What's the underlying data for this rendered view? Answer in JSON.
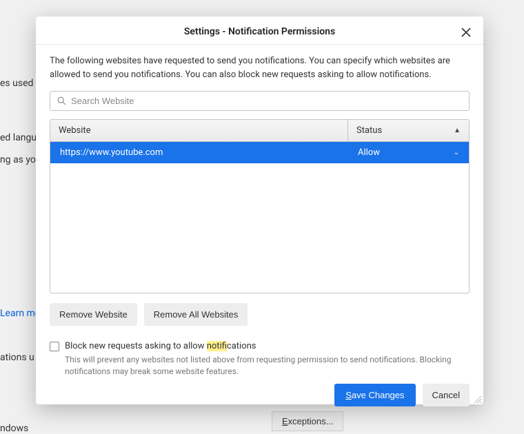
{
  "background": {
    "frag1": "es used",
    "frag2": "ed langu",
    "frag3": "ng as yo",
    "frag4": "Learn mo",
    "frag5": "ations u",
    "frag6": "ndows",
    "exceptions_label": "Exceptions..."
  },
  "dialog": {
    "title": "Settings - Notification Permissions",
    "description": "The following websites have requested to send you notifications. You can specify which websites are allowed to send you notifications. You can also block new requests asking to allow notifications.",
    "search": {
      "placeholder": "Search Website"
    },
    "table": {
      "header": {
        "website": "Website",
        "status": "Status"
      },
      "rows": [
        {
          "website": "https://www.youtube.com",
          "status": "Allow"
        }
      ]
    },
    "buttons": {
      "remove_website": "Remove Website",
      "remove_all": "Remove All Websites"
    },
    "checkbox": {
      "label_pre": "Block new requests asking to allow ",
      "label_highlight": "notif",
      "label_post": "ications",
      "description": "This will prevent any websites not listed above from requesting permission to send notifications. Blocking notifications may break some website features."
    },
    "footer": {
      "save": "Save Changes",
      "cancel": "Cancel"
    }
  }
}
